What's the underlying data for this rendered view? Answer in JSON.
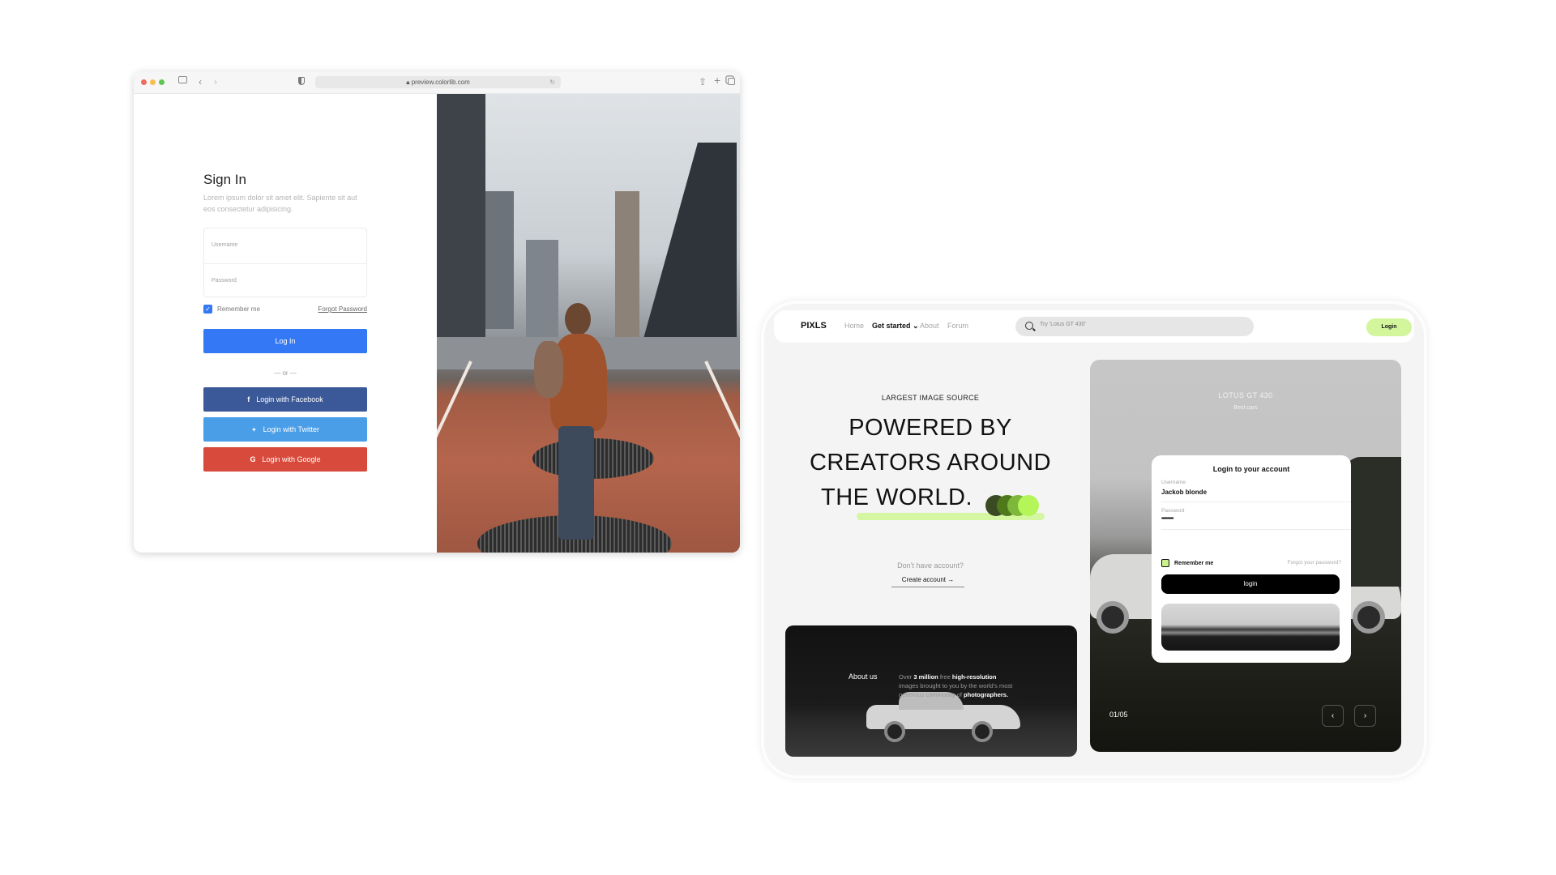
{
  "browser": {
    "url": "preview.colorlib.com",
    "traffic_lights": [
      "#ed6a5e",
      "#f5bf4f",
      "#61c554"
    ],
    "toolbar_icons": [
      "sidebar-icon",
      "back-icon",
      "forward-icon",
      "shield-icon",
      "share-icon",
      "new-tab-icon",
      "tabs-icon"
    ],
    "page": {
      "title": "Sign In",
      "subtitle": "Lorem ipsum dolor sit amet elit. Sapiente sit aut eos consectetur adipisicing.",
      "username_placeholder": "Username",
      "password_placeholder": "Password",
      "remember_label": "Remember me",
      "remember_checked": true,
      "forgot_label": "Forgot Password",
      "login_button": "Log In",
      "divider": "— or —",
      "social": [
        {
          "label": "Login with Facebook",
          "icon": "f",
          "color": "#3b5998"
        },
        {
          "label": "Login with Twitter",
          "icon": "🐦",
          "color": "#4a9ee8"
        },
        {
          "label": "Login with Google",
          "icon": "G",
          "color": "#d84b3c"
        }
      ]
    }
  },
  "tablet": {
    "nav": {
      "logo": "PIXLS",
      "links": [
        "Home",
        "Get started",
        "About",
        "Forum"
      ],
      "active_link": "Get started",
      "search_placeholder": "Try 'Lotus GT 430'",
      "login_button": "Login",
      "accent": "#d3f59b"
    },
    "hero": {
      "eyebrow": "LARGEST IMAGE SOURCE",
      "lines": [
        "POWERED BY",
        "CREATORS AROUND",
        "THE WORLD."
      ],
      "circle_colors": [
        "#3a4a22",
        "#4f7a1c",
        "#7db83a",
        "#b4f55a"
      ],
      "no_account": "Don't have account?",
      "create_account": "Create account →"
    },
    "about": {
      "title": "About us",
      "text_prefix": "Over ",
      "text_bold1": "3 million",
      "text_mid1": " free ",
      "text_bold2": "high-resolution",
      "text_mid2": " images brought to you by the world's most generous community of ",
      "text_bold3": "photographers."
    },
    "showcase": {
      "title": "LOTUS GT 430",
      "subtitle": "Best cars",
      "counter": "01/05",
      "prev_icon": "‹",
      "next_icon": "›"
    },
    "login_card": {
      "title": "Login to your account",
      "username_label": "Username",
      "username_value": "Jackob blonde",
      "password_label": "Password",
      "password_value": "••••••••••",
      "remember_label": "Remember me",
      "forgot_label": "Forgot your password?",
      "login_button": "login"
    }
  }
}
